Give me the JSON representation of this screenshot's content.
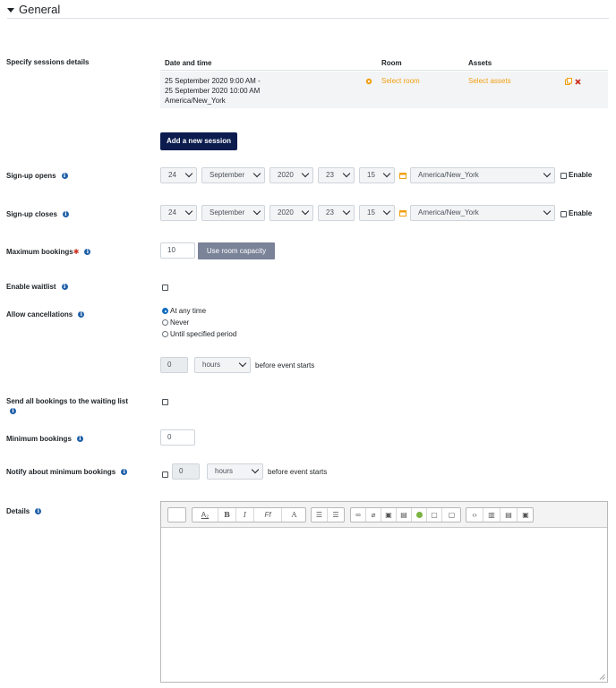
{
  "section": {
    "title": "General"
  },
  "sessions": {
    "label": "Specify sessions details",
    "headers": {
      "date": "Date and time",
      "room": "Room",
      "assets": "Assets"
    },
    "row": {
      "date_line1": "25 September 2020 9:00 AM -",
      "date_line2": "25 September 2020 10:00 AM",
      "timezone": "America/New_York",
      "room_link": "Select room",
      "assets_link": "Select assets"
    },
    "add_button": "Add a new session"
  },
  "signup_opens": {
    "label": "Sign-up opens",
    "day": "24",
    "month": "September",
    "year": "2020",
    "hour": "23",
    "minute": "15",
    "timezone": "America/New_York",
    "enable": "Enable"
  },
  "signup_closes": {
    "label": "Sign-up closes",
    "day": "24",
    "month": "September",
    "year": "2020",
    "hour": "23",
    "minute": "15",
    "timezone": "America/New_York",
    "enable": "Enable"
  },
  "max_bookings": {
    "label": "Maximum bookings",
    "value": "10",
    "button": "Use room capacity"
  },
  "waitlist": {
    "label": "Enable waitlist"
  },
  "cancellations": {
    "label": "Allow cancellations",
    "options": [
      "At any time",
      "Never",
      "Until specified period"
    ],
    "selected": 0,
    "period_value": "0",
    "period_unit": "hours",
    "period_suffix": "before event starts"
  },
  "send_all": {
    "label": "Send all bookings to the waiting list"
  },
  "min_bookings": {
    "label": "Minimum bookings",
    "value": "0"
  },
  "notify_min": {
    "label": "Notify about minimum bookings",
    "value": "0",
    "unit": "hours",
    "suffix": "before event starts"
  },
  "details": {
    "label": "Details"
  },
  "colors": {
    "accent": "#0c1c4e",
    "link": "#f0a012",
    "info": "#1f5fa8",
    "required": "#ca3120"
  }
}
